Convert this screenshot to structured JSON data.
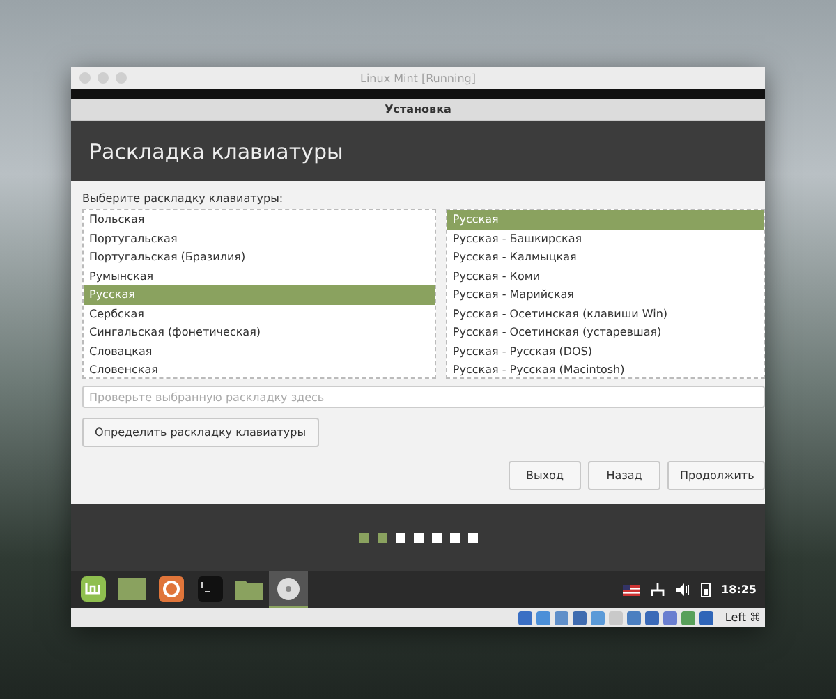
{
  "window": {
    "title": "Linux Mint [Running]"
  },
  "installer": {
    "title": "Установка",
    "heading": "Раскладка клавиатуры"
  },
  "prompt": "Выберите раскладку клавиатуры:",
  "layouts": [
    {
      "label": "Польская",
      "selected": false
    },
    {
      "label": "Португальская",
      "selected": false
    },
    {
      "label": "Португальская (Бразилия)",
      "selected": false
    },
    {
      "label": "Румынская",
      "selected": false
    },
    {
      "label": "Русская",
      "selected": true
    },
    {
      "label": "Сербская",
      "selected": false
    },
    {
      "label": "Сингальская (фонетическая)",
      "selected": false
    },
    {
      "label": "Словацкая",
      "selected": false
    },
    {
      "label": "Словенская",
      "selected": false
    }
  ],
  "variants": [
    {
      "label": "Русская",
      "selected": true
    },
    {
      "label": "Русская - Башкирская",
      "selected": false
    },
    {
      "label": "Русская - Калмыцкая",
      "selected": false
    },
    {
      "label": "Русская - Коми",
      "selected": false
    },
    {
      "label": "Русская - Марийская",
      "selected": false
    },
    {
      "label": "Русская - Осетинская (клавиши Win)",
      "selected": false
    },
    {
      "label": "Русская - Осетинская (устаревшая)",
      "selected": false
    },
    {
      "label": "Русская - Русская (DOS)",
      "selected": false
    },
    {
      "label": "Русская - Русская (Macintosh)",
      "selected": false
    }
  ],
  "test_field": {
    "placeholder": "Проверьте выбранную раскладку здесь"
  },
  "detect_button": "Определить раскладку клавиатуры",
  "buttons": [
    "Выход",
    "Назад",
    "Продолжить"
  ],
  "steps": [
    {
      "done": true
    },
    {
      "done": true
    },
    {
      "done": false
    },
    {
      "done": false
    },
    {
      "done": false
    },
    {
      "done": false
    },
    {
      "done": false
    }
  ],
  "taskbar": [
    {
      "kind": "menu",
      "selected": false
    },
    {
      "kind": "desktop",
      "selected": false
    },
    {
      "kind": "browser",
      "selected": false
    },
    {
      "kind": "terminal",
      "selected": false
    },
    {
      "kind": "folder",
      "selected": false
    },
    {
      "kind": "disc",
      "selected": true
    }
  ],
  "tray": {
    "clock": "18:25"
  },
  "vm_status": {
    "host_key": "Left ⌘"
  }
}
